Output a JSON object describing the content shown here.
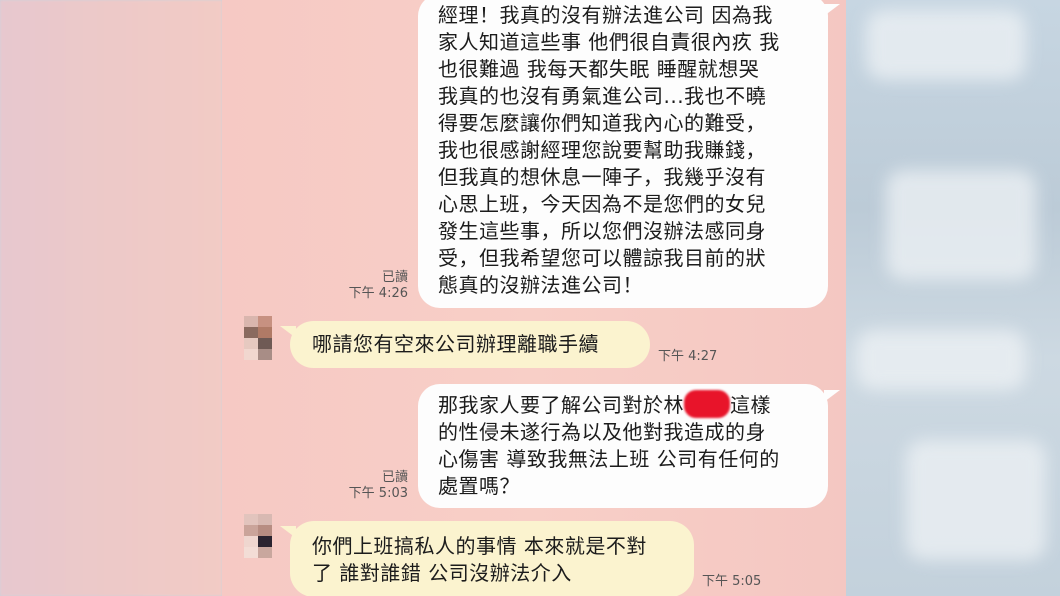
{
  "messages": [
    {
      "id": "m1",
      "sender": "me",
      "lines": [
        "經理！我真的沒有辦法進公司 因為我",
        "家人知道這些事 他們很自責很內疚 我",
        "也很難過 我每天都失眠 睡醒就想哭",
        "我真的也沒有勇氣進公司...我也不曉",
        "得要怎麼讓你們知道我內心的難受，",
        "我也很感謝經理您說要幫助我賺錢，",
        "但我真的想休息一陣子，我幾乎沒有",
        "心思上班，今天因為不是您們的女兒",
        "發生這些事，所以您們沒辦法感同身",
        "受，但我希望您可以體諒我目前的狀",
        "態真的沒辦法進公司！"
      ],
      "read": "已讀",
      "time": "下午 4:26"
    },
    {
      "id": "m2",
      "sender": "them",
      "lines": [
        "哪請您有空來公司辦理離職手續"
      ],
      "time": "下午 4:27"
    },
    {
      "id": "m3",
      "sender": "me",
      "line1_before": "那我家人要了解公司對於林",
      "line1_after": "這樣",
      "lines_rest": [
        "的性侵未遂行為以及他對我造成的身",
        "心傷害 導致我無法上班 公司有任何的",
        "處置嗎？"
      ],
      "read": "已讀",
      "time": "下午 5:03"
    },
    {
      "id": "m4",
      "sender": "them",
      "lines": [
        "你們上班搞私人的事情 本來就是不對",
        "了 誰對誰錯 公司沒辦法介入"
      ],
      "time": "下午 5:05"
    }
  ],
  "colors": {
    "chat_bg": "#f8cfc7",
    "my_bubble": "#fdfdfd",
    "their_bubble": "#fbf3cf",
    "redaction": "#e8142a"
  }
}
